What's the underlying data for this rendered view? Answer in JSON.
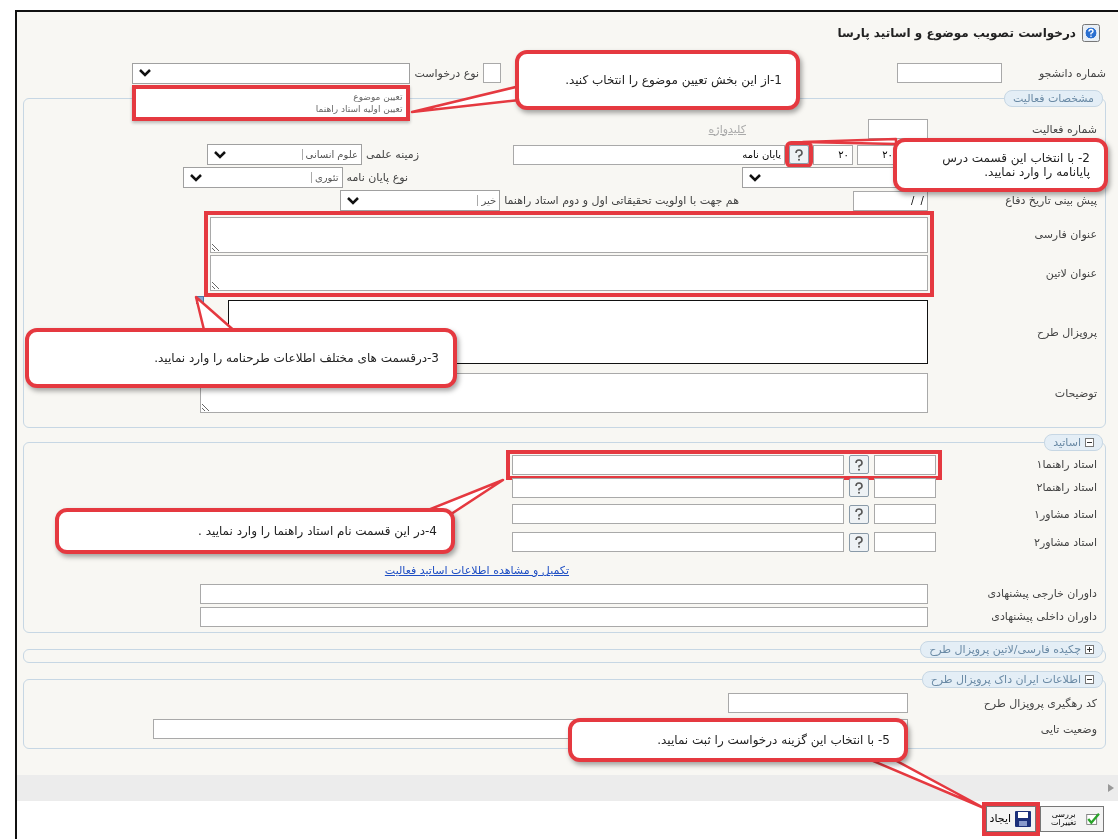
{
  "title": "درخواست تصویب موضوع و اساتید پارسا",
  "student_number_label": "شماره دانشجو",
  "request_type": {
    "label": "نوع درخواست",
    "expanded": true,
    "highlighted": true,
    "options": [
      {
        "label": "تعیین موضوع",
        "selected": false
      },
      {
        "label": "تعیین اولیه استاد راهنما",
        "selected": false
      }
    ]
  },
  "activity_section": {
    "legend": "مشخصات فعالیت",
    "activity_number_label": "شماره فعالیت",
    "keywords_link": {
      "label": "کلیدواژه",
      "disabled": true
    },
    "course": {
      "code_1": "۲۰",
      "code_2": "۲۰",
      "name": "پایان نامه",
      "help_highlighted": true
    },
    "field_label": "زمینه علمی",
    "field_value": "علوم انسانی",
    "thesis_type_label": "نوع پایان نامه",
    "thesis_type_value": "تئوری",
    "defense_date_label": "پیش بینی تاریخ دفاع",
    "defense_date_value": "/  /",
    "aligned_label": "هم جهت با اولویت تحقیقاتی اول و دوم استاد راهنما",
    "aligned_value": "خیر",
    "titles_highlighted": true,
    "titles": [
      {
        "label": "عنوان فارسی"
      },
      {
        "label": "عنوان لاتین"
      }
    ],
    "proposal_label": "پروپزال طرح",
    "notes_label": "توضیحات"
  },
  "professors_section": {
    "legend": "اساتید",
    "expanded": true,
    "rows": [
      {
        "label": "استاد راهنما۱",
        "highlighted": true
      },
      {
        "label": "استاد راهنما۲",
        "highlighted": false
      },
      {
        "label": "استاد مشاور۱",
        "highlighted": false
      },
      {
        "label": "استاد مشاور۲",
        "highlighted": false
      }
    ],
    "link": "تکمیل و مشاهده اطلاعات اساتید فعالیت",
    "referees": [
      {
        "label": "داوران خارجی پیشنهادی"
      },
      {
        "label": "داوران داخلی پیشنهادی"
      }
    ]
  },
  "abstract_section": {
    "legend": "چکیده فارسی/لاتین پروپزال طرح",
    "expanded": false
  },
  "irandoc_section": {
    "legend": "اطلاعات ایران داک پروپزال طرح",
    "expanded": true,
    "fields": [
      {
        "label": "کد رهگیری پروپزال طرح",
        "kind": "short"
      },
      {
        "label": "وضعیت تایی",
        "kind": "long"
      }
    ]
  },
  "toolbar": [
    {
      "label": "بررسی تغییرات",
      "kind": "review",
      "highlighted": false
    },
    {
      "label": "ایجاد",
      "kind": "save",
      "highlighted": true
    }
  ],
  "callouts": [
    {
      "text": "1-از این بخش تعیین موضوع را انتخاب کنید."
    },
    {
      "text": "2- با انتخاب این قسمت درس پایانامه را وارد نمایید."
    },
    {
      "text": "3-درقسمت های مختلف اطلاعات طرحنامه را وارد نمایید."
    },
    {
      "text": "4-در این قسمت نام استاد راهنما را وارد نمایید ."
    },
    {
      "text": "5- با انتخاب این گزینه درخواست را ثبت نمایید."
    }
  ]
}
